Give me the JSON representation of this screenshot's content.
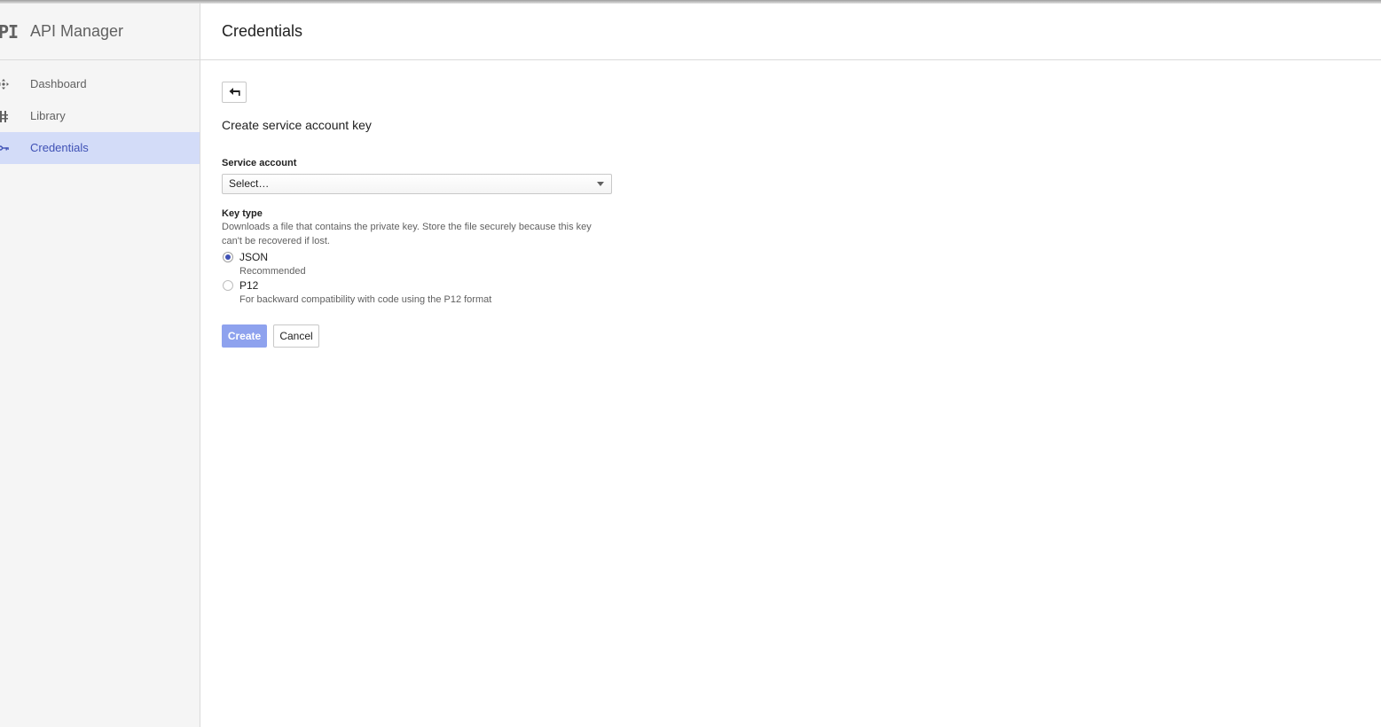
{
  "app": {
    "logo_text": "PI",
    "title": "API Manager"
  },
  "sidebar": {
    "items": [
      {
        "label": "Dashboard",
        "icon": "dashboard-icon",
        "active": false
      },
      {
        "label": "Library",
        "icon": "library-icon",
        "active": false
      },
      {
        "label": "Credentials",
        "icon": "key-icon",
        "active": true
      }
    ]
  },
  "header": {
    "title": "Credentials"
  },
  "form": {
    "back_icon": "back-arrow-icon",
    "title": "Create service account key",
    "service_account": {
      "label": "Service account",
      "value": "Select…"
    },
    "key_type": {
      "label": "Key type",
      "help": "Downloads a file that contains the private key. Store the file securely because this key can't be recovered if lost.",
      "options": [
        {
          "label": "JSON",
          "description": "Recommended",
          "checked": true
        },
        {
          "label": "P12",
          "description": "For backward compatibility with code using the P12 format",
          "checked": false
        }
      ]
    },
    "create_label": "Create",
    "cancel_label": "Cancel"
  },
  "colors": {
    "accent": "#3f51b5",
    "active_nav_bg": "#d3dcf8",
    "create_button_bg": "#8ea2ee",
    "sidebar_bg": "#f5f5f5"
  }
}
